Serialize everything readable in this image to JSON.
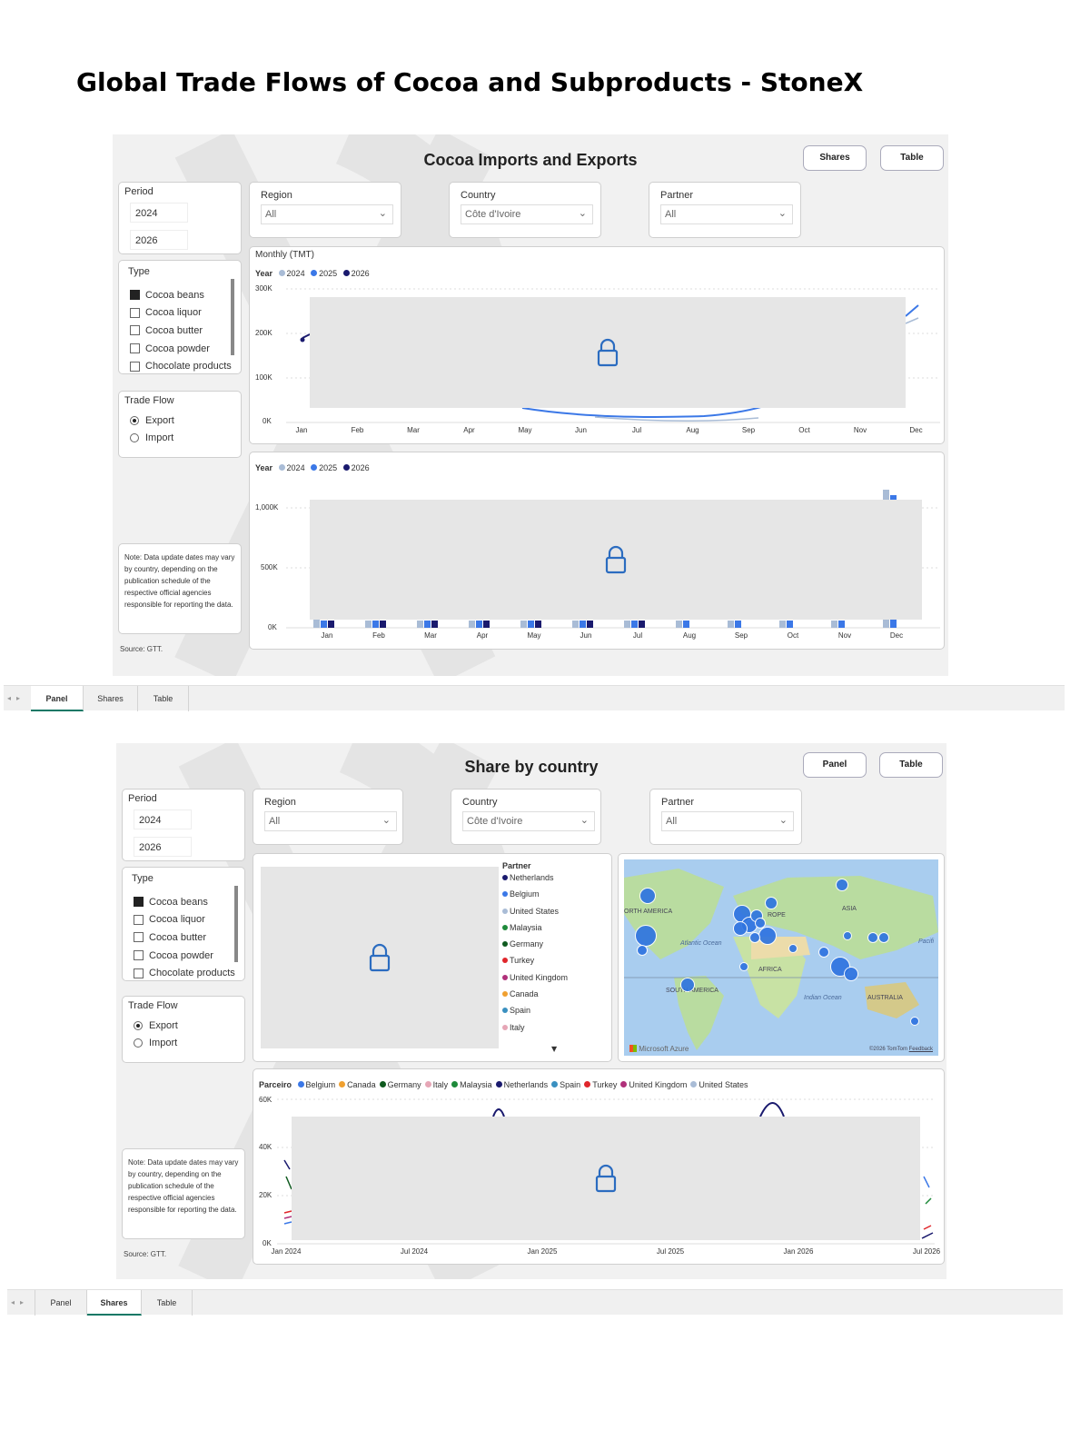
{
  "page_title": "Global Trade Flows of Cocoa and Subproducts - StoneX",
  "colors": {
    "y2024": "#a9bcd6",
    "y2025": "#3b78e7",
    "y2026": "#1a1a6e",
    "tab_accent": "#117865"
  },
  "panel": {
    "title": "Cocoa Imports and Exports",
    "nav_buttons": [
      "Shares",
      "Table"
    ],
    "period": {
      "label": "Period",
      "from": "2024",
      "to": "2026"
    },
    "region": {
      "label": "Region",
      "value": "All"
    },
    "country": {
      "label": "Country",
      "value": "Côte d'Ivoire"
    },
    "partner": {
      "label": "Partner",
      "value": "All"
    },
    "type": {
      "label": "Type",
      "options": [
        "Cocoa beans",
        "Cocoa liquor",
        "Cocoa butter",
        "Cocoa powder",
        "Chocolate products"
      ],
      "selected": "Cocoa beans"
    },
    "trade_flow": {
      "label": "Trade Flow",
      "options": [
        "Export",
        "Import"
      ],
      "selected": "Export"
    },
    "note": "Note: Data update dates may vary by country, depending on the publication schedule of the respective official agencies responsible for reporting the data.",
    "source": "Source: GTT.",
    "line_chart": {
      "title": "Monthly (TMT)",
      "legend_title": "Year",
      "series": [
        "2024",
        "2025",
        "2026"
      ],
      "yticks": [
        "300K",
        "200K",
        "100K",
        "0K"
      ],
      "months": [
        "Jan",
        "Feb",
        "Mar",
        "Apr",
        "May",
        "Jun",
        "Jul",
        "Aug",
        "Sep",
        "Oct",
        "Nov",
        "Dec"
      ],
      "locked": true
    },
    "bar_chart": {
      "legend_title": "Year",
      "series": [
        "2024",
        "2025",
        "2026"
      ],
      "yticks": [
        "1,000K",
        "500K",
        "0K"
      ],
      "months": [
        "Jan",
        "Feb",
        "Mar",
        "Apr",
        "May",
        "Jun",
        "Jul",
        "Aug",
        "Sep",
        "Oct",
        "Nov",
        "Dec"
      ],
      "locked": true
    }
  },
  "tabs_1": {
    "items": [
      "Panel",
      "Shares",
      "Table"
    ],
    "active": "Panel"
  },
  "shares": {
    "title": "Share by country",
    "nav_buttons": [
      "Panel",
      "Table"
    ],
    "period": {
      "label": "Period",
      "from": "2024",
      "to": "2026"
    },
    "region": {
      "label": "Region",
      "value": "All"
    },
    "country": {
      "label": "Country",
      "value": "Côte d'Ivoire"
    },
    "partner": {
      "label": "Partner",
      "value": "All"
    },
    "type": {
      "label": "Type",
      "options": [
        "Cocoa beans",
        "Cocoa liquor",
        "Cocoa butter",
        "Cocoa powder",
        "Chocolate products"
      ],
      "selected": "Cocoa beans"
    },
    "trade_flow": {
      "label": "Trade Flow",
      "options": [
        "Export",
        "Import"
      ],
      "selected": "Export"
    },
    "note": "Note: Data update dates may vary by country, depending on the publication schedule of the respective official agencies responsible for reporting the data.",
    "source": "Source: GTT.",
    "partner_legend": {
      "title": "Partner",
      "items": [
        {
          "name": "Netherlands",
          "color": "#1a1a6e"
        },
        {
          "name": "Belgium",
          "color": "#3b78e7"
        },
        {
          "name": "United States",
          "color": "#a9bcd6"
        },
        {
          "name": "Malaysia",
          "color": "#1e8a3a"
        },
        {
          "name": "Germany",
          "color": "#0f5a1f"
        },
        {
          "name": "Turkey",
          "color": "#e0262b"
        },
        {
          "name": "United Kingdom",
          "color": "#b0307a"
        },
        {
          "name": "Canada",
          "color": "#f0a030"
        },
        {
          "name": "Spain",
          "color": "#3a90c0"
        },
        {
          "name": "Italy",
          "color": "#e6a6b6"
        }
      ]
    },
    "map": {
      "labels": [
        "ORTH AMERICA",
        "ROPE",
        "ASIA",
        "Atlantic Ocean",
        "AFRICA",
        "Pacifi",
        "SOUTH AMERICA",
        "Indian Ocean",
        "AUSTRALIA"
      ],
      "brand": "Microsoft Azure",
      "copyright": "©2026 TomTom",
      "feedback": "Feedback"
    },
    "line_chart": {
      "legend_title": "Parceiro",
      "legend": [
        {
          "name": "Belgium",
          "color": "#3b78e7"
        },
        {
          "name": "Canada",
          "color": "#f0a030"
        },
        {
          "name": "Germany",
          "color": "#0f5a1f"
        },
        {
          "name": "Italy",
          "color": "#e6a6b6"
        },
        {
          "name": "Malaysia",
          "color": "#1e8a3a"
        },
        {
          "name": "Netherlands",
          "color": "#1a1a6e"
        },
        {
          "name": "Spain",
          "color": "#3a90c0"
        },
        {
          "name": "Turkey",
          "color": "#e0262b"
        },
        {
          "name": "United Kingdom",
          "color": "#b0307a"
        },
        {
          "name": "United States",
          "color": "#a9bcd6"
        }
      ],
      "yticks": [
        "60K",
        "40K",
        "20K",
        "0K"
      ],
      "xticks": [
        "Jan 2024",
        "Jul 2024",
        "Jan 2025",
        "Jul 2025",
        "Jan 2026",
        "Jul 2026"
      ],
      "locked": true
    }
  },
  "tabs_2": {
    "items": [
      "Panel",
      "Shares",
      "Table"
    ],
    "active": "Shares"
  }
}
